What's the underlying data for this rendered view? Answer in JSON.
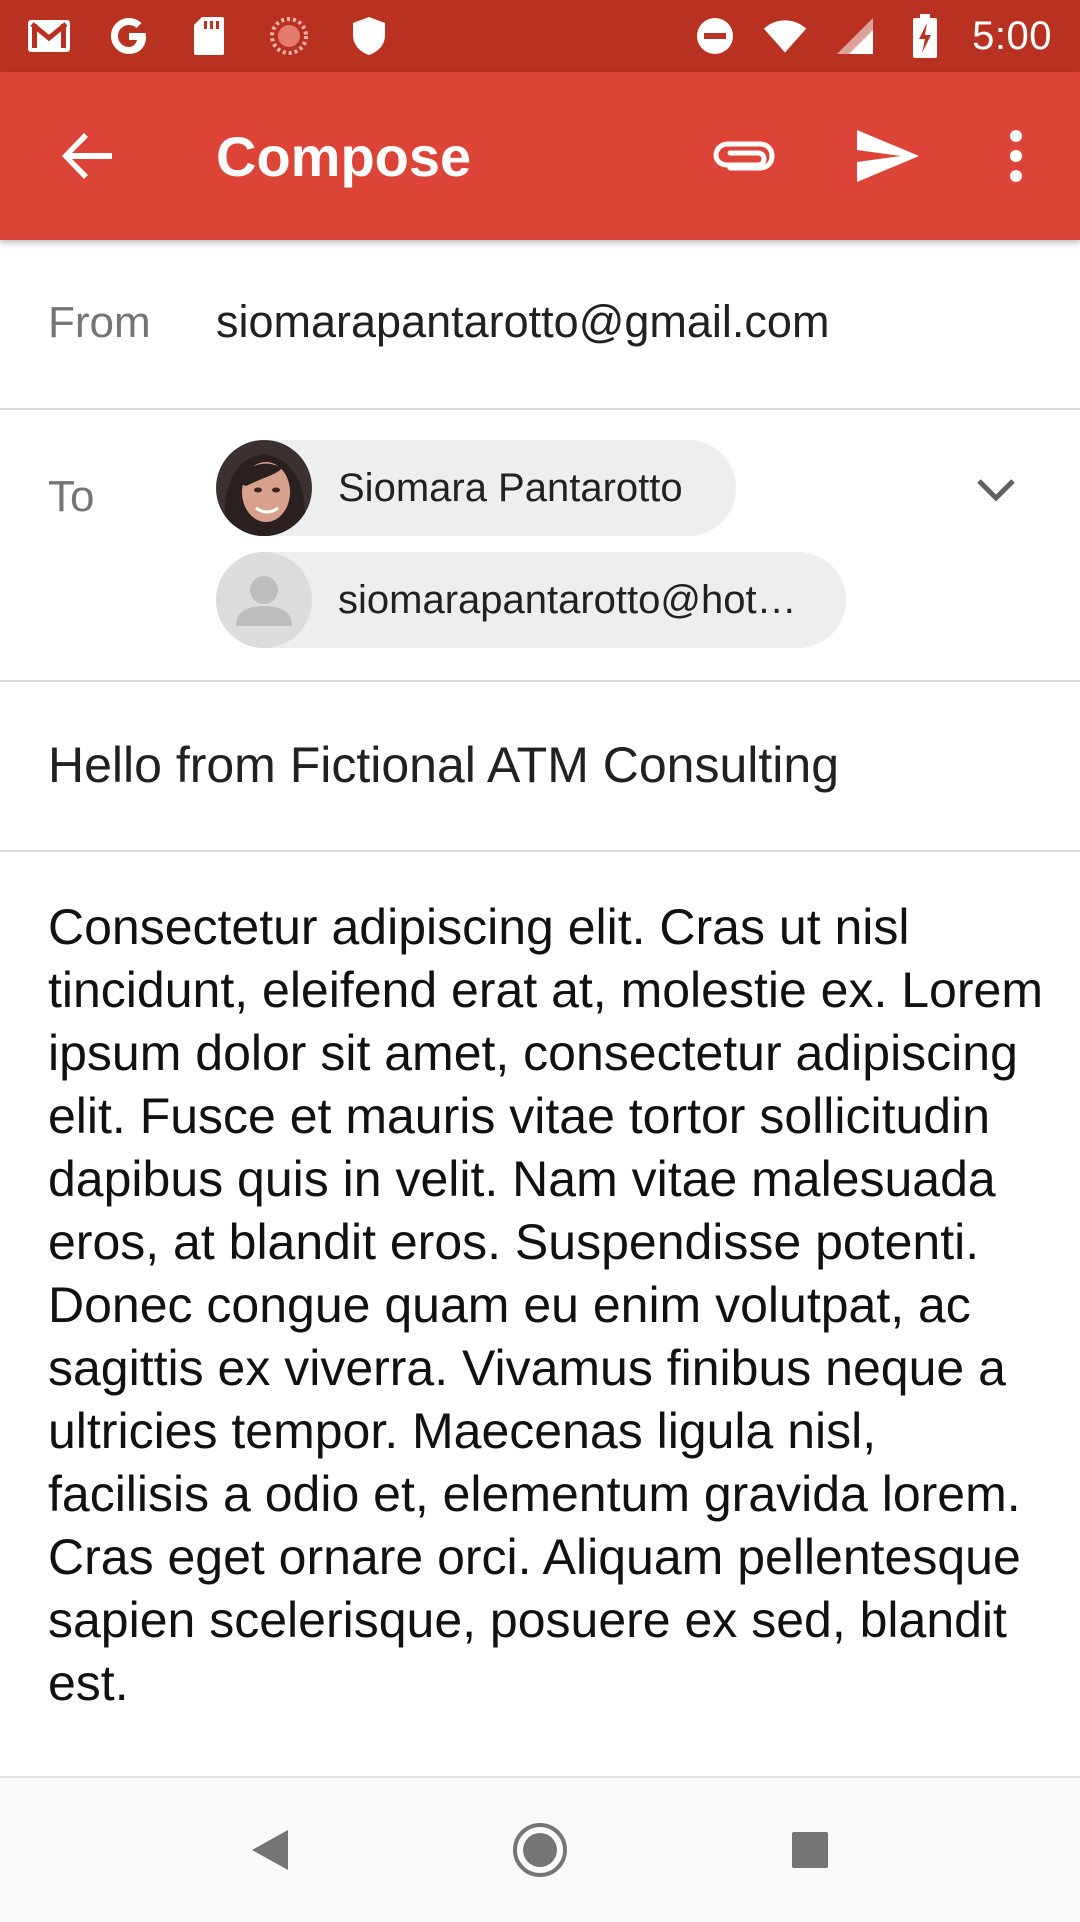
{
  "status_bar": {
    "time": "5:00",
    "left_icons": [
      "gmail-icon",
      "google-icon",
      "sd-card-icon",
      "sync-icon",
      "shield-icon"
    ],
    "right_icons": [
      "do-not-disturb-icon",
      "wifi-icon",
      "signal-icon",
      "battery-charging-icon"
    ]
  },
  "app_bar": {
    "title": "Compose",
    "icons": [
      "back-arrow-icon",
      "attach-icon",
      "send-icon",
      "more-vert-icon"
    ]
  },
  "from": {
    "label": "From",
    "value": "siomarapantarotto@gmail.com"
  },
  "to": {
    "label": "To",
    "recipients": [
      {
        "name": "Siomara Pantarotto",
        "avatar": "photo"
      },
      {
        "name": "siomarapantarotto@hot…",
        "avatar": "placeholder-person-icon"
      }
    ]
  },
  "subject": "Hello from Fictional ATM Consulting",
  "body": "Consectetur adipiscing elit. Cras ut nisl tincidunt, eleifend erat at, molestie ex. Lorem ipsum dolor sit amet, consectetur adipiscing elit. Fusce et mauris vitae tortor sollicitudin dapibus quis in velit. Nam vitae malesuada eros, at blandit eros. Suspendisse potenti. Donec congue quam eu enim volutpat, ac sagittis ex viverra. Vivamus finibus neque a ultricies tempor. Maecenas ligula nisl, facilisis a odio et, elementum gravida lorem. Cras eget ornare orci. Aliquam pellentesque sapien scelerisque, posuere ex sed, blandit est.",
  "colors": {
    "status_bar": "#b93221",
    "app_bar": "#db4437",
    "chip_bg": "#eeeeee"
  },
  "nav_bar": {
    "icons": [
      "nav-back-icon",
      "nav-home-icon",
      "nav-recents-icon"
    ]
  }
}
